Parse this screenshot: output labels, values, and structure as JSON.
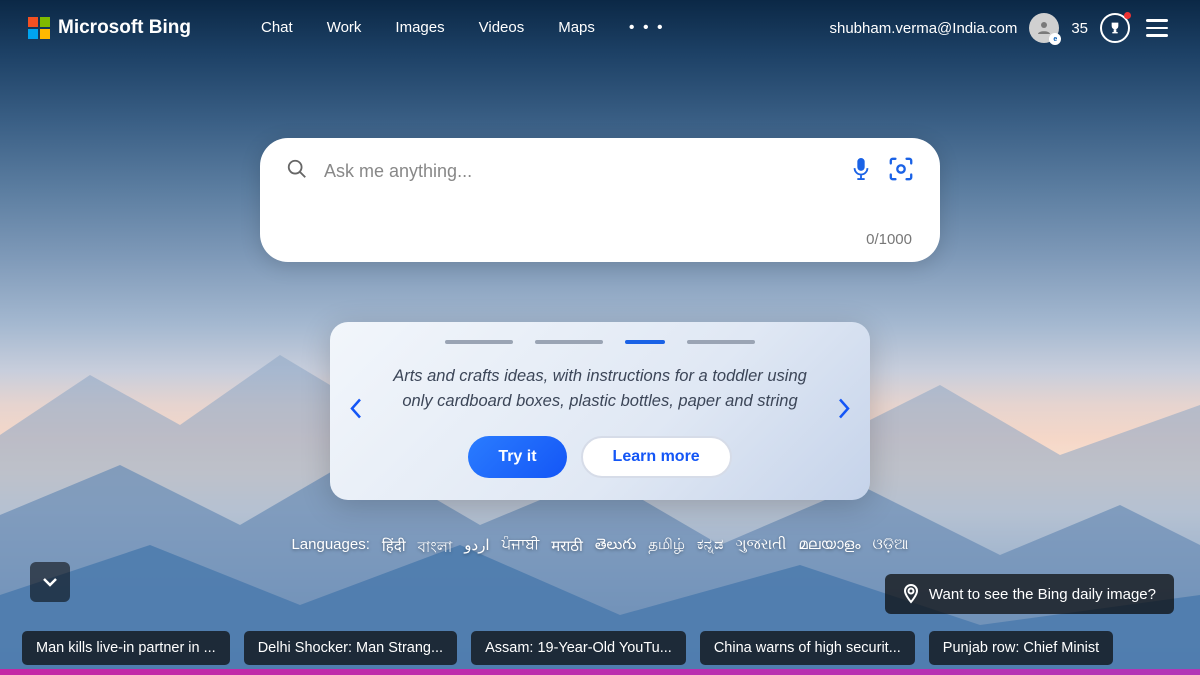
{
  "header": {
    "brand": "Microsoft Bing",
    "nav": {
      "chat": "Chat",
      "work": "Work",
      "images": "Images",
      "videos": "Videos",
      "maps": "Maps"
    },
    "user_email": "shubham.verma@India.com",
    "points": "35"
  },
  "search": {
    "placeholder": "Ask me anything...",
    "value": "",
    "counter": "0/1000"
  },
  "promo": {
    "text": "Arts and crafts ideas, with instructions for a toddler using only cardboard boxes, plastic bottles, paper and string",
    "try_label": "Try it",
    "learn_label": "Learn more"
  },
  "languages": {
    "label": "Languages:",
    "items": [
      "हिंदी",
      "বাংলা",
      "اردو",
      "ਪੰਜਾਬੀ",
      "मराठी",
      "తెలుగు",
      "தமிழ்",
      "ಕನ್ನಡ",
      "ગુજરાતી",
      "മലയാളം",
      "ଓଡ଼ିଆ"
    ]
  },
  "daily_image_prompt": "Want to see the Bing daily image?",
  "ticker": [
    "Man kills live-in partner in ...",
    "Delhi Shocker: Man Strang...",
    "Assam: 19-Year-Old YouTu...",
    "China warns of high securit...",
    "Punjab row: Chief Minist"
  ]
}
